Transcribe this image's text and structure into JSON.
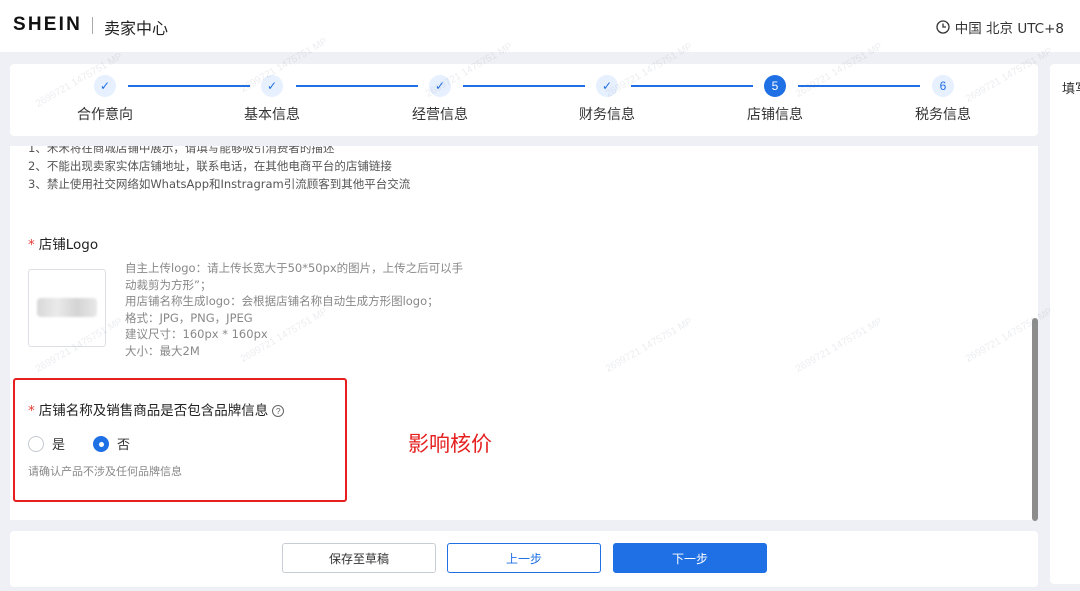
{
  "header": {
    "brand": "SHEIN",
    "portal": "卖家中心",
    "timezone": "中国 北京 UTC+8"
  },
  "steps": [
    {
      "label": "合作意向",
      "status": "done",
      "mark": "✓"
    },
    {
      "label": "基本信息",
      "status": "done",
      "mark": "✓"
    },
    {
      "label": "经营信息",
      "status": "done",
      "mark": "✓"
    },
    {
      "label": "财务信息",
      "status": "done",
      "mark": "✓"
    },
    {
      "label": "店铺信息",
      "status": "active",
      "mark": "5"
    },
    {
      "label": "税务信息",
      "status": "todo",
      "mark": "6"
    }
  ],
  "side_panel": {
    "title": "填写"
  },
  "rules": [
    "1、禾禾将在商城店铺中展示，请填写能够吸引消费者的描述",
    "2、不能出现卖家实体店铺地址，联系电话，在其他电商平台的店铺链接",
    "3、禁止使用社交网络如WhatsApp和Instragram引流顾客到其他平台交流"
  ],
  "logo_field": {
    "required_mark": "*",
    "title": "店铺Logo",
    "desc": [
      "自主上传logo：请上传长宽大于50*50px的图片，上传之后可以手动裁剪为方形”；",
      "用店铺名称生成logo：会根据店铺名称自动生成方形图logo；",
      "格式：JPG，PNG，JPEG",
      "建议尺寸：160px * 160px",
      "大小：最大2M"
    ]
  },
  "brand_field": {
    "required_mark": "*",
    "title": "店铺名称及销售商品是否包含品牌信息",
    "help": "?",
    "options": [
      {
        "label": "是",
        "selected": false
      },
      {
        "label": "否",
        "selected": true
      }
    ],
    "hint": "请确认产品不涉及任何品牌信息"
  },
  "annotation": "影响核价",
  "footer": {
    "save_draft": "保存至草稿",
    "prev": "上一步",
    "next": "下一步"
  },
  "watermark": "2699721 1475751 MP",
  "colors": {
    "accent": "#1f6fe5",
    "annotation": "#e5201f"
  }
}
